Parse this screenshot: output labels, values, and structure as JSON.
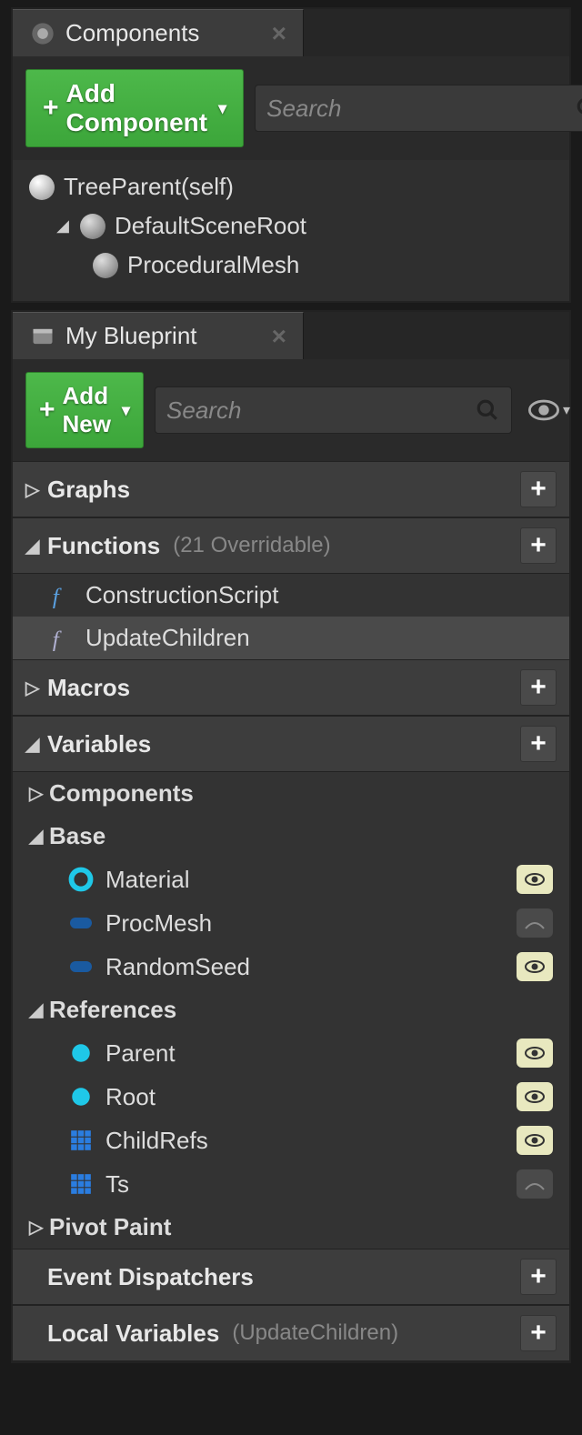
{
  "componentsPanel": {
    "tabTitle": "Components",
    "addButton": "Add Component",
    "searchPlaceholder": "Search",
    "tree": {
      "root": "TreeParent(self)",
      "sceneRoot": "DefaultSceneRoot",
      "child": "ProceduralMesh"
    }
  },
  "blueprintPanel": {
    "tabTitle": "My Blueprint",
    "addButton": "Add New",
    "searchPlaceholder": "Search",
    "sections": {
      "graphs": {
        "label": "Graphs"
      },
      "functions": {
        "label": "Functions",
        "note": "(21 Overridable)",
        "items": [
          "ConstructionScript",
          "UpdateChildren"
        ]
      },
      "macros": {
        "label": "Macros"
      },
      "variables": {
        "label": "Variables",
        "groups": {
          "components": {
            "label": "Components"
          },
          "base": {
            "label": "Base",
            "items": [
              {
                "name": "Material",
                "icon": "ring-cyan",
                "eye": "on"
              },
              {
                "name": "ProcMesh",
                "icon": "pill-blue",
                "eye": "off"
              },
              {
                "name": "RandomSeed",
                "icon": "pill-blue",
                "eye": "on"
              }
            ]
          },
          "references": {
            "label": "References",
            "items": [
              {
                "name": "Parent",
                "icon": "dot-cyan",
                "eye": "on"
              },
              {
                "name": "Root",
                "icon": "dot-cyan",
                "eye": "on"
              },
              {
                "name": "ChildRefs",
                "icon": "grid-blue",
                "eye": "on"
              },
              {
                "name": "Ts",
                "icon": "grid-blue",
                "eye": "off"
              }
            ]
          },
          "pivotPaint": {
            "label": "Pivot Paint"
          }
        }
      },
      "eventDispatchers": {
        "label": "Event Dispatchers"
      },
      "localVariables": {
        "label": "Local Variables",
        "note": "(UpdateChildren)"
      }
    }
  }
}
